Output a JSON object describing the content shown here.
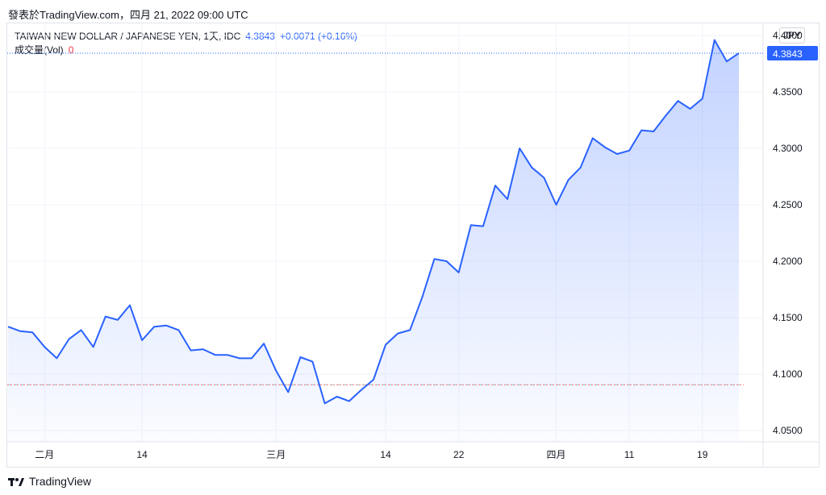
{
  "header": {
    "text": "發表於TradingView.com，四月 21, 2022 09:00 UTC"
  },
  "legend": {
    "symbol": "TAIWAN NEW DOLLAR / JAPANESE YEN, 1天, IDC",
    "last_price": "4.3843",
    "change": "+0.0071 (+0.16%)",
    "volume_label": "成交量(Vol)",
    "volume_value": "0"
  },
  "currency_button": "JPY",
  "footer": {
    "brand": "TradingView"
  },
  "colors": {
    "line": "#2962ff",
    "fill_top": "#2962ff",
    "price_tag_bg": "#2962ff",
    "baseline_red": "#f23645",
    "baseline_green": "#089981"
  },
  "chart_data": {
    "type": "area",
    "ylim": [
      4.04,
      4.41
    ],
    "y_ticks": [
      "4.0500",
      "4.1000",
      "4.1500",
      "4.2000",
      "4.2500",
      "4.3000",
      "4.3500",
      "4.4000"
    ],
    "x_tick_labels": [
      "二月",
      "14",
      "三月",
      "14",
      "22",
      "四月",
      "11",
      "19"
    ],
    "x_tick_index": [
      3,
      11,
      22,
      31,
      37,
      45,
      51,
      57
    ],
    "last_value_label": "4.3843",
    "last_value": 4.3843,
    "baseline_value": 4.0905,
    "grid": true,
    "values": [
      4.142,
      4.138,
      4.137,
      4.124,
      4.114,
      4.131,
      4.139,
      4.124,
      4.151,
      4.148,
      4.161,
      4.13,
      4.142,
      4.143,
      4.139,
      4.121,
      4.122,
      4.117,
      4.117,
      4.114,
      4.114,
      4.127,
      4.103,
      4.084,
      4.115,
      4.111,
      4.074,
      4.08,
      4.076,
      4.086,
      4.095,
      4.126,
      4.136,
      4.139,
      4.168,
      4.202,
      4.2,
      4.19,
      4.232,
      4.231,
      4.267,
      4.255,
      4.3,
      4.283,
      4.274,
      4.25,
      4.272,
      4.283,
      4.309,
      4.301,
      4.295,
      4.298,
      4.316,
      4.315,
      4.329,
      4.342,
      4.335,
      4.344,
      4.396,
      4.377,
      4.3843
    ]
  }
}
